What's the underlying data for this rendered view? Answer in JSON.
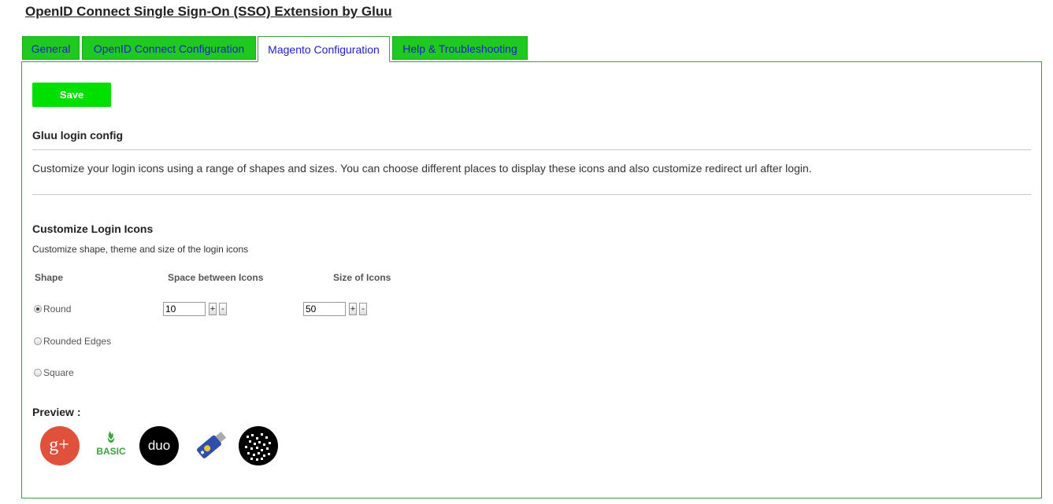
{
  "page_title": "OpenID Connect Single Sign-On (SSO) Extension by Gluu",
  "tabs": [
    {
      "label": "General"
    },
    {
      "label": "OpenID Connect Configuration"
    },
    {
      "label": "Magento Configuration"
    },
    {
      "label": "Help & Troubleshooting"
    }
  ],
  "save_label": "Save",
  "login_config": {
    "title": "Gluu login config",
    "description": "Customize your login icons using a range of shapes and sizes. You can choose different places to display these icons and also customize redirect url after login."
  },
  "customize": {
    "title": "Customize Login Icons",
    "subtitle": "Customize shape, theme and size of the login icons",
    "col_shape": "Shape",
    "col_space": "Space between Icons",
    "col_size": "Size of Icons",
    "shapes": [
      {
        "label": "Round",
        "checked": true
      },
      {
        "label": "Rounded Edges",
        "checked": false
      },
      {
        "label": "Square",
        "checked": false
      }
    ],
    "space_value": "10",
    "size_value": "50",
    "plus": "+",
    "minus": "-"
  },
  "preview": {
    "title": "Preview :",
    "icons": [
      "google-plus-icon",
      "basic-icon",
      "duo-icon",
      "u2f-key-icon",
      "qr-code-icon"
    ],
    "icon_labels": {
      "google": "g+",
      "basic": "BASIC",
      "duo": "duo"
    }
  },
  "colors": {
    "tab_green": "#1fc91f",
    "save_green": "#00e000",
    "border_green": "#3aa53a",
    "link_blue": "#2020d0"
  }
}
